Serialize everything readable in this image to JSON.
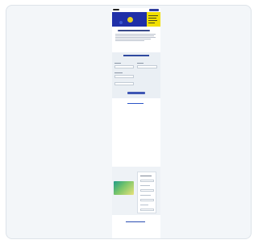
{
  "page": {
    "preview_label": "",
    "hero": {
      "headline": ""
    },
    "form": {
      "title": ""
    },
    "promo": {
      "title": ""
    }
  }
}
